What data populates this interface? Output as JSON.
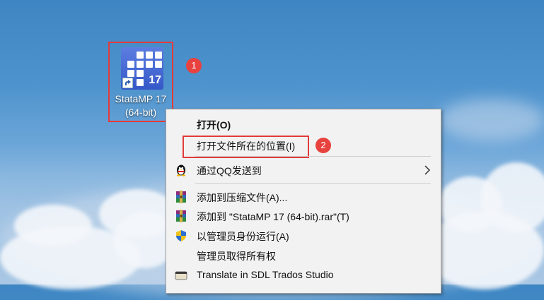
{
  "shortcut": {
    "label_line1": "StataMP 17",
    "label_line2": "(64-bit)",
    "icon_text": "17"
  },
  "annotations": {
    "step1": "1",
    "step2": "2"
  },
  "menu": {
    "items": [
      {
        "label": "打开(O)"
      },
      {
        "label": "打开文件所在的位置(I)"
      },
      {
        "label": "通过QQ发送到"
      },
      {
        "label": "添加到压缩文件(A)..."
      },
      {
        "label": "添加到 \"StataMP 17 (64-bit).rar\"(T)"
      },
      {
        "label": "以管理员身份运行(A)"
      },
      {
        "label": "管理员取得所有权"
      },
      {
        "label": "Translate in SDL Trados Studio"
      }
    ]
  },
  "icons": {
    "shortcut": "stata-app-icon",
    "shortcut_overlay": "shortcut-arrow-icon",
    "qq": "qq-penguin-icon",
    "archive": "winrar-icon",
    "admin": "uac-shield-icon",
    "trados": "trados-icon",
    "submenu": "chevron-right-icon"
  },
  "colors": {
    "annotation_red": "#e23b3b",
    "menu_bg": "#f2f2f2",
    "stata_blue": "#3f63d0"
  }
}
